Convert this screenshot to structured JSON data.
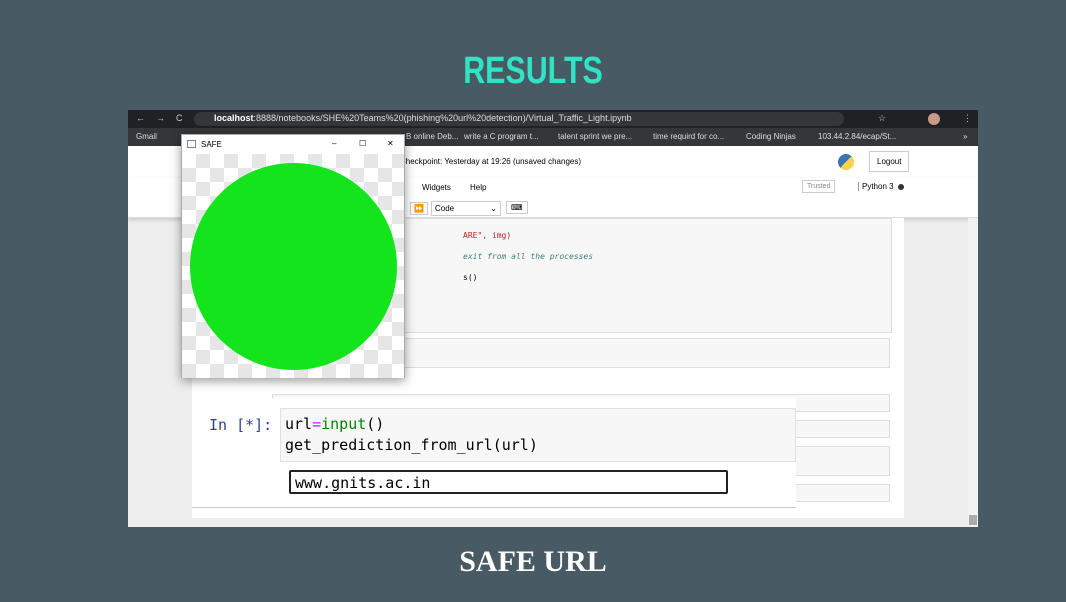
{
  "slide": {
    "title": "RESULTS",
    "caption": "SAFE URL"
  },
  "browser": {
    "url_host": "localhost",
    "url_rest": ":8888/notebooks/SHE%20Teams%20(phishing%20url%20detection)/Virtual_Traffic_Light.ipynb",
    "bookmarks": [
      "Gmail",
      "B online Deb...",
      "write a C program t...",
      "talent sprint we pre...",
      "time requird for co...",
      "Coding Ninjas",
      "103.44.2.84/ecap/St..."
    ],
    "more": "»"
  },
  "jupyter": {
    "checkpoint": "Checkpoint: Yesterday at 19:26  (unsaved changes)",
    "logout": "Logout",
    "menu": [
      "Widgets",
      "Help"
    ],
    "trusted": "Trusted",
    "kernel": "Python 3",
    "cell_type": "Code",
    "code_lines": [
      "ARE\", img)",
      "exit from all the processes",
      "s()"
    ]
  },
  "popup": {
    "title": "SAFE",
    "minimize": "–",
    "maximize": "☐",
    "close": "✕"
  },
  "cell": {
    "prompt": "In [*]:",
    "line1_var": "url",
    "line1_op": "=",
    "line1_fn": "input",
    "line1_rest": "()",
    "line2": "get_prediction_from_url(url)",
    "input_value": "www.gnits.ac.in"
  },
  "colors": {
    "background": "#485a64",
    "title": "#2fe3c4",
    "signal": "#13e41b"
  }
}
